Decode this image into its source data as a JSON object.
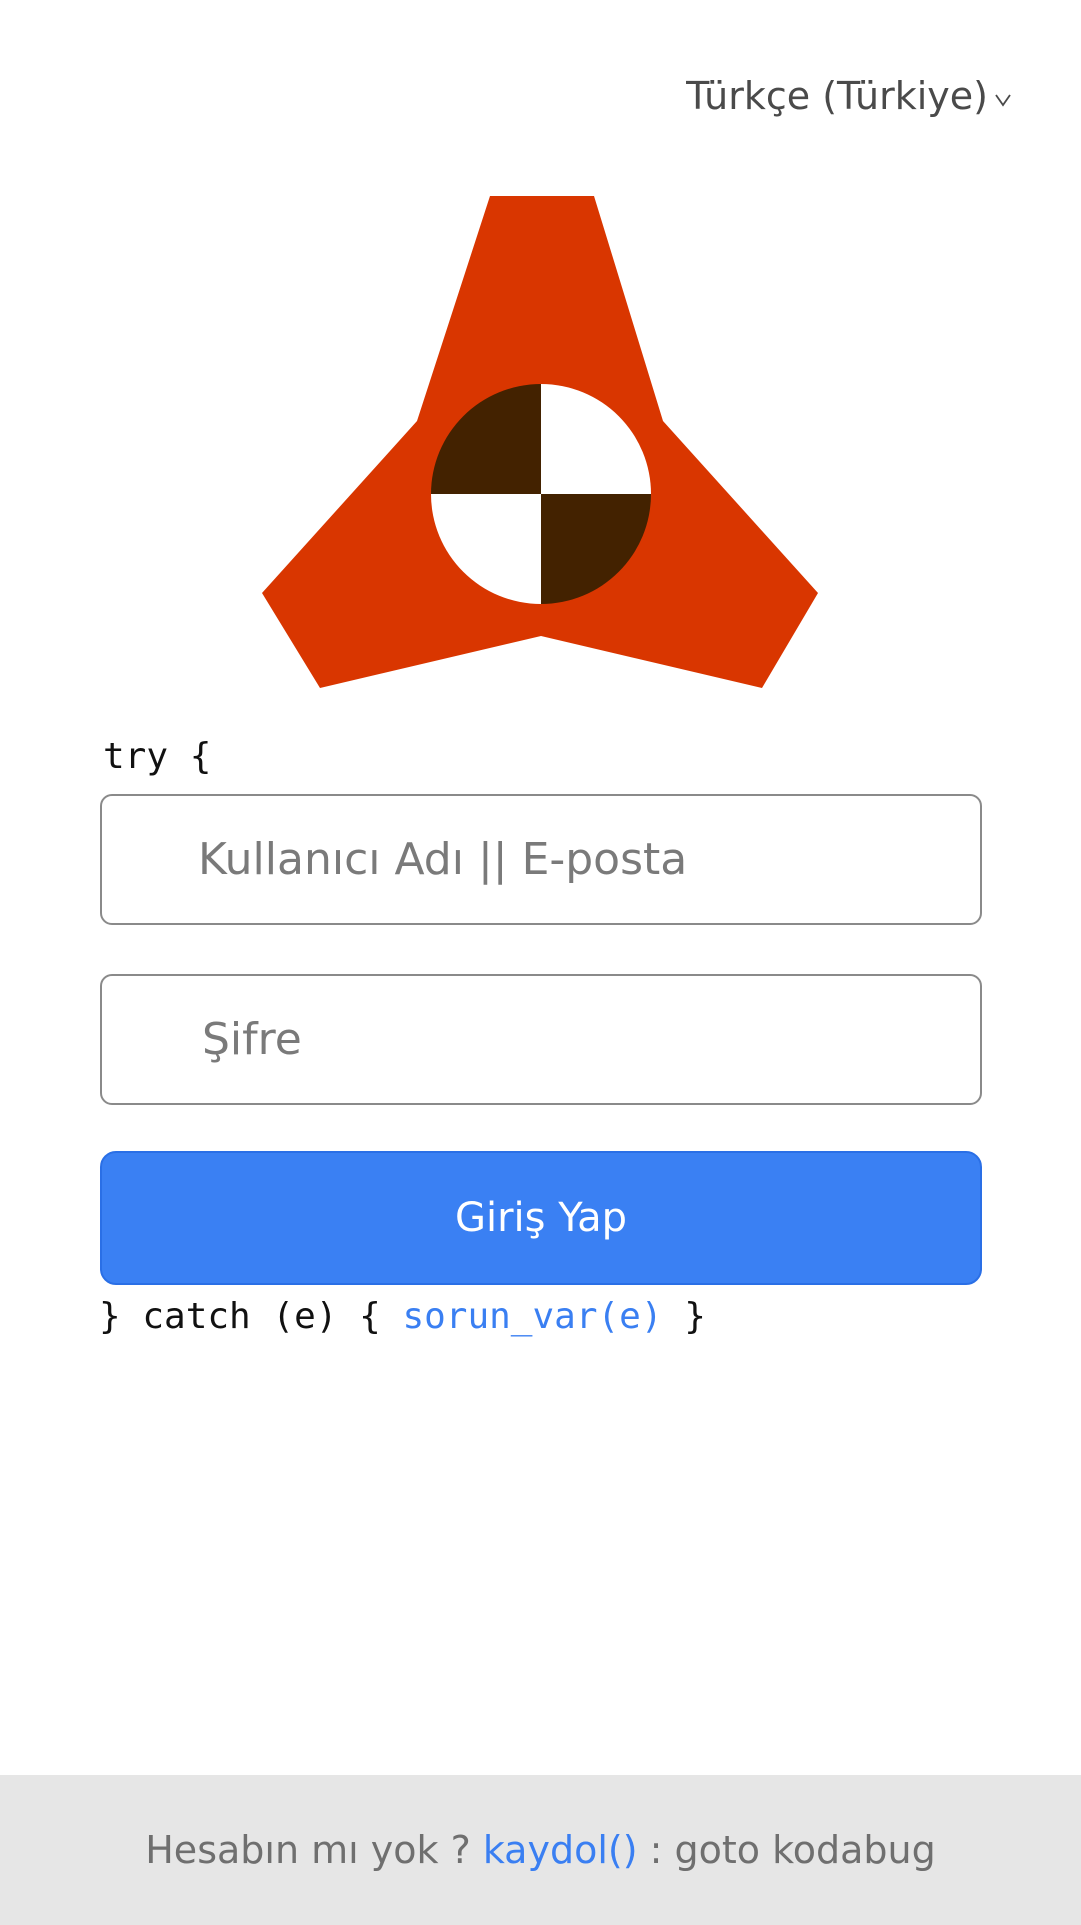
{
  "language_selector": {
    "label": "Türkçe (Türkiye)",
    "icon": "chevron-down-icon"
  },
  "logo": {
    "name": "app-logo",
    "colors": {
      "primary": "#d93600",
      "dark": "#432200",
      "light": "#ffffff"
    }
  },
  "form": {
    "try_line": "try {",
    "username_placeholder": "Kullanıcı Adı || E-posta",
    "password_placeholder": "Şifre",
    "submit_label": "Giriş Yap",
    "catch_prefix": "} catch (e) { ",
    "catch_link": "sorun_var(e)",
    "catch_suffix": " }"
  },
  "footer": {
    "prompt": "Hesabın mı yok ? ",
    "signup_link": "kaydol()",
    "suffix": " : goto kodabug"
  },
  "colors": {
    "accent": "#3a80f3",
    "link": "#3a7ff2",
    "footer_bg": "#e6e6e6"
  }
}
